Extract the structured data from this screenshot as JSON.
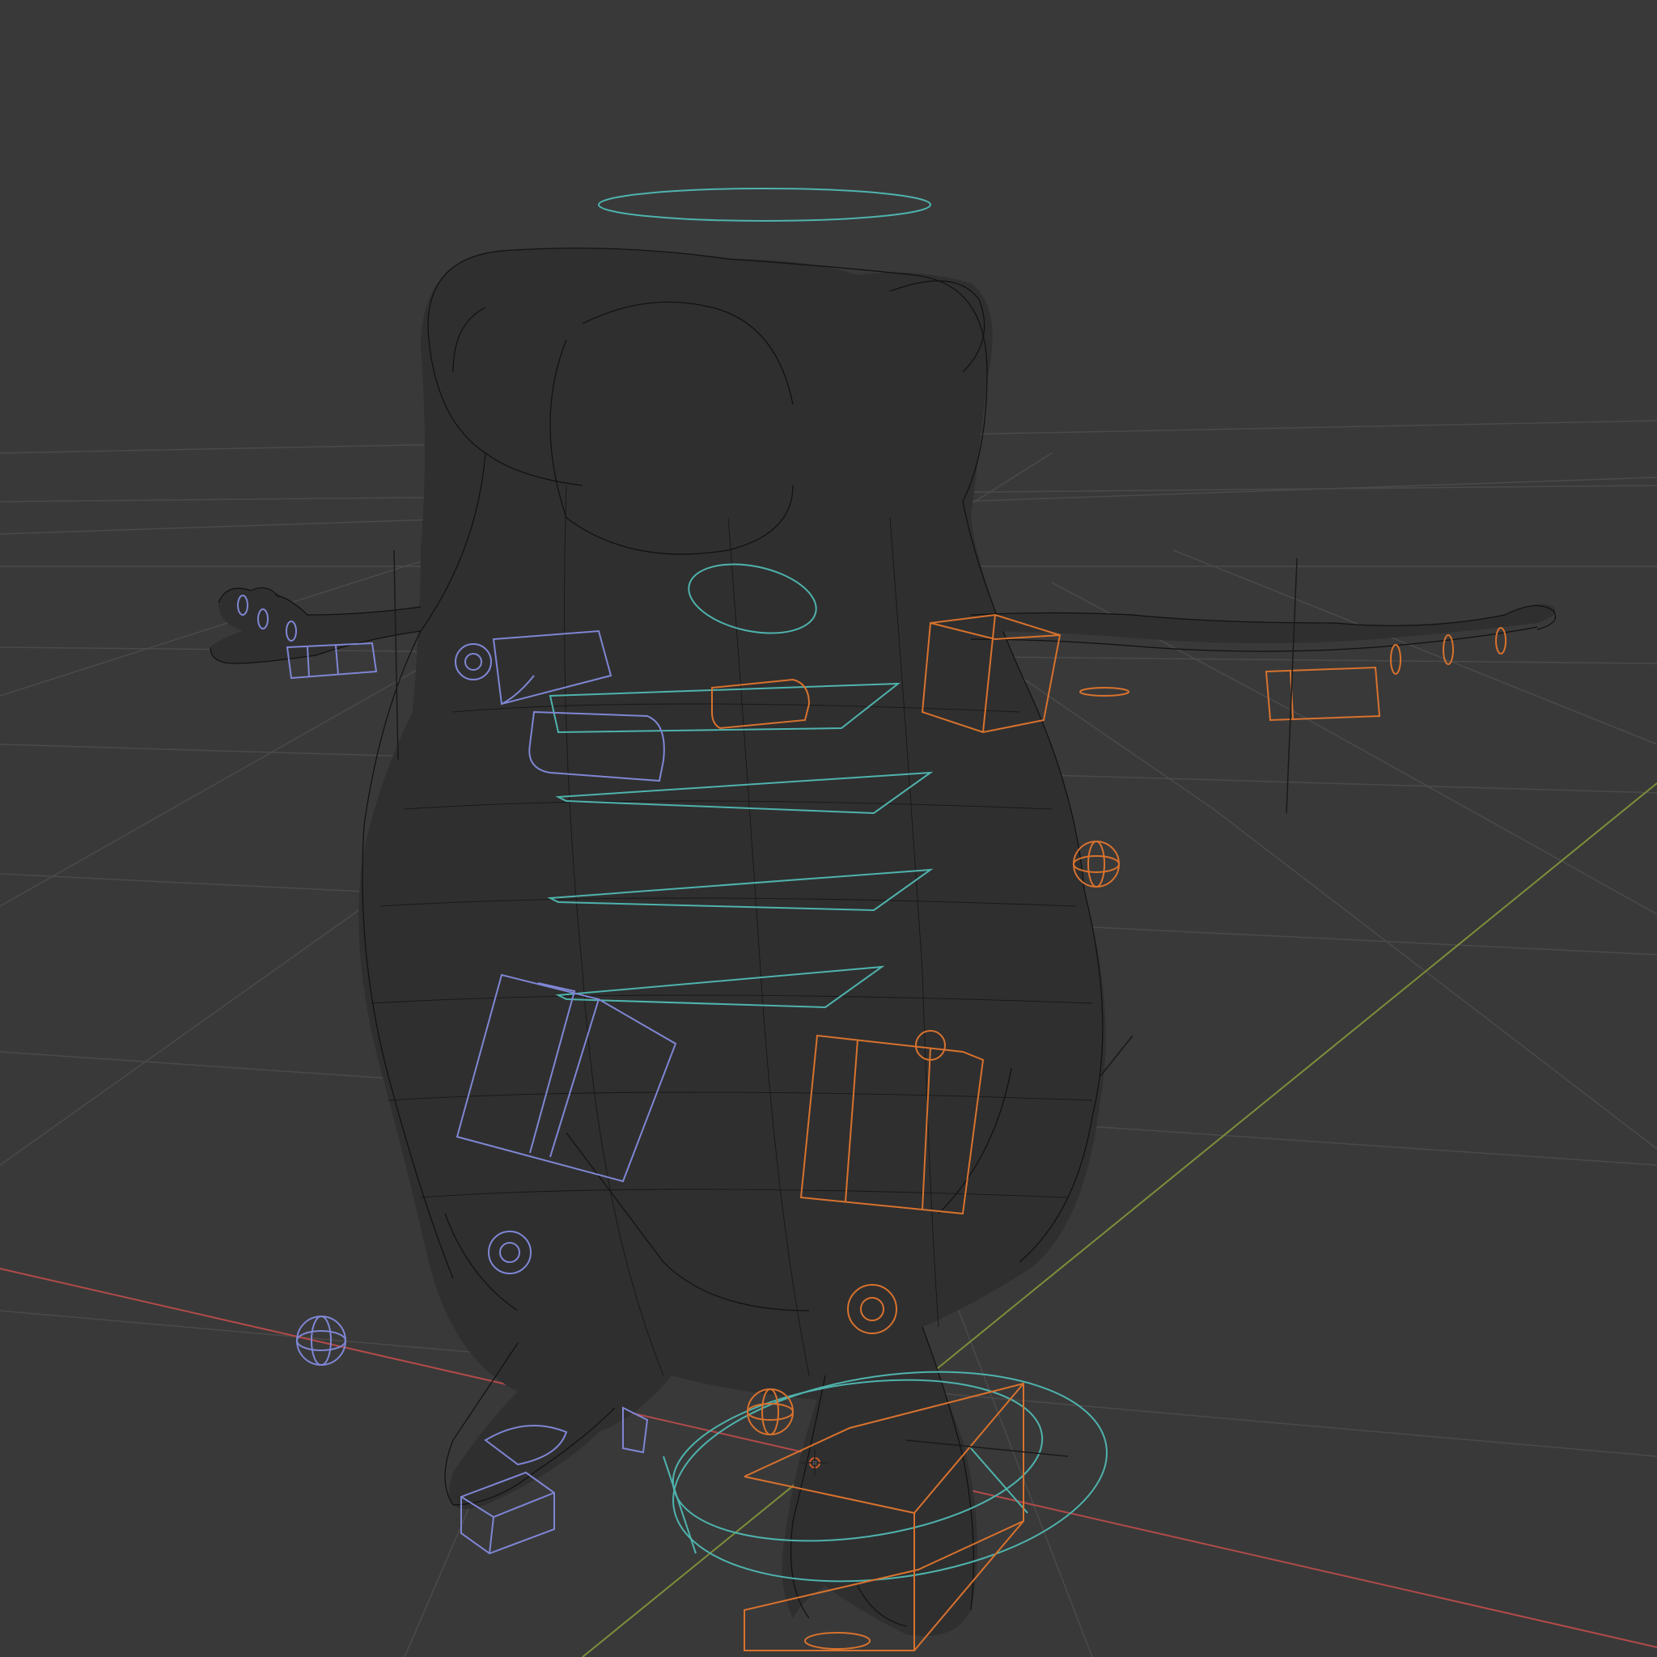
{
  "viewport": {
    "mode": "wireframe",
    "background_color": "#393939",
    "grid_color": "#4a4a4a",
    "mesh_color": "#111111",
    "axis_x_color": "#b24a4a",
    "axis_y_color": "#7c8f3a"
  },
  "controls": {
    "center_color": "#4fb3ad",
    "left_side_color": "#7f86d4",
    "right_side_color": "#d8722e"
  },
  "scene": {
    "object": "character-mesh",
    "armature": "rig-controls"
  }
}
